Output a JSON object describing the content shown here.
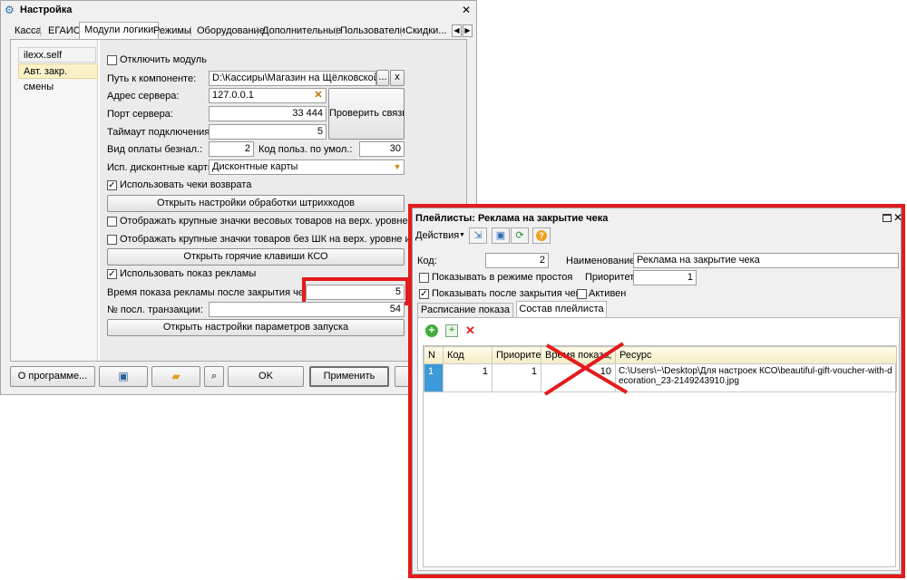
{
  "settings_window": {
    "title": "Настройка",
    "close_glyph": "✕",
    "tabs": [
      "Касса",
      "ЕГАИС",
      "Модули логики",
      "Режимы",
      "Оборудование",
      "Дополнительные",
      "Пользователи",
      "Скидки..."
    ],
    "modules": [
      "ilexx.self",
      "Авт. закр. смены"
    ],
    "disable_module": "Отключить модуль",
    "component_path_label": "Путь к компоненте:",
    "component_path_value": "D:\\Кассиры\\Магазин на Щёлковской\\Ка",
    "browse_label": "...",
    "clear_label": "x",
    "server_address_label": "Адрес сервера:",
    "server_address_value": "127.0.0.1",
    "server_port_label": "Порт сервера:",
    "server_port_value": "33 444",
    "check_connection": "Проверить связь",
    "timeout_label": "Таймаут подключения, с:",
    "timeout_value": "5",
    "cashless_label": "Вид оплаты безнал.:",
    "cashless_value": "2",
    "default_user_label": "Код польз. по умол.:",
    "default_user_value": "30",
    "discount_cards_label": "Исп. дисконтные карты:",
    "discount_cards_value": "Дисконтные карты",
    "use_return_checks": "Использовать чеки возврата",
    "barcode_settings_btn": "Открыть настройки обработки штрихкодов",
    "large_weight_icons": "Отображать крупные значки весовых товаров на верх. уровне иерархии",
    "large_no_barcode_icons": "Отображать крупные значки товаров без ШК на верх. уровне иерархии",
    "hotkeys_btn": "Открыть горячие клавиши КСО",
    "use_ads": "Использовать показ рекламы",
    "ad_time_label": "Время показа рекламы после закрытия чека, с:",
    "ad_time_value": "5",
    "last_transaction_label": "№ посл. транзакции:",
    "last_transaction_value": "54",
    "launch_params_btn": "Открыть настройки параметров запуска",
    "about_btn": "О программе...",
    "ok_btn": "OK",
    "apply_btn": "Применить"
  },
  "playlist_window": {
    "title": "Плейлисты: Реклама на закрытие чека",
    "actions_label": "Действия",
    "code_label": "Код:",
    "code_value": "2",
    "name_label": "Наименование:",
    "name_value": "Реклама на закрытие чека",
    "show_idle": "Показывать в режиме простоя",
    "priority_label": "Приоритет:",
    "priority_value": "1",
    "show_after_close": "Показывать после закрытия чека",
    "active_label": "Активен",
    "tabs": [
      "Расписание показа",
      "Состав плейлиста"
    ],
    "columns": [
      "N",
      "Код",
      "Приоритет",
      "Время показа, с.",
      "Ресурс"
    ],
    "rows": [
      {
        "n": "1",
        "code": "1",
        "priority": "1",
        "time": "10",
        "resource": "C:\\Users\\~\\Desktop\\Для настроек КСО\\beautiful-gift-voucher-with-decoration_23-2149243910.jpg"
      }
    ]
  },
  "colors": {
    "highlight_red": "#e41a1c",
    "panel_bg": "#f0f0f0",
    "form_bg": "#e9e9e9",
    "tab_active": "#ffffff",
    "module_selected": "#fbf1c9",
    "grid_header": "#f7efcc",
    "row_marker": "#3d9ad9"
  }
}
